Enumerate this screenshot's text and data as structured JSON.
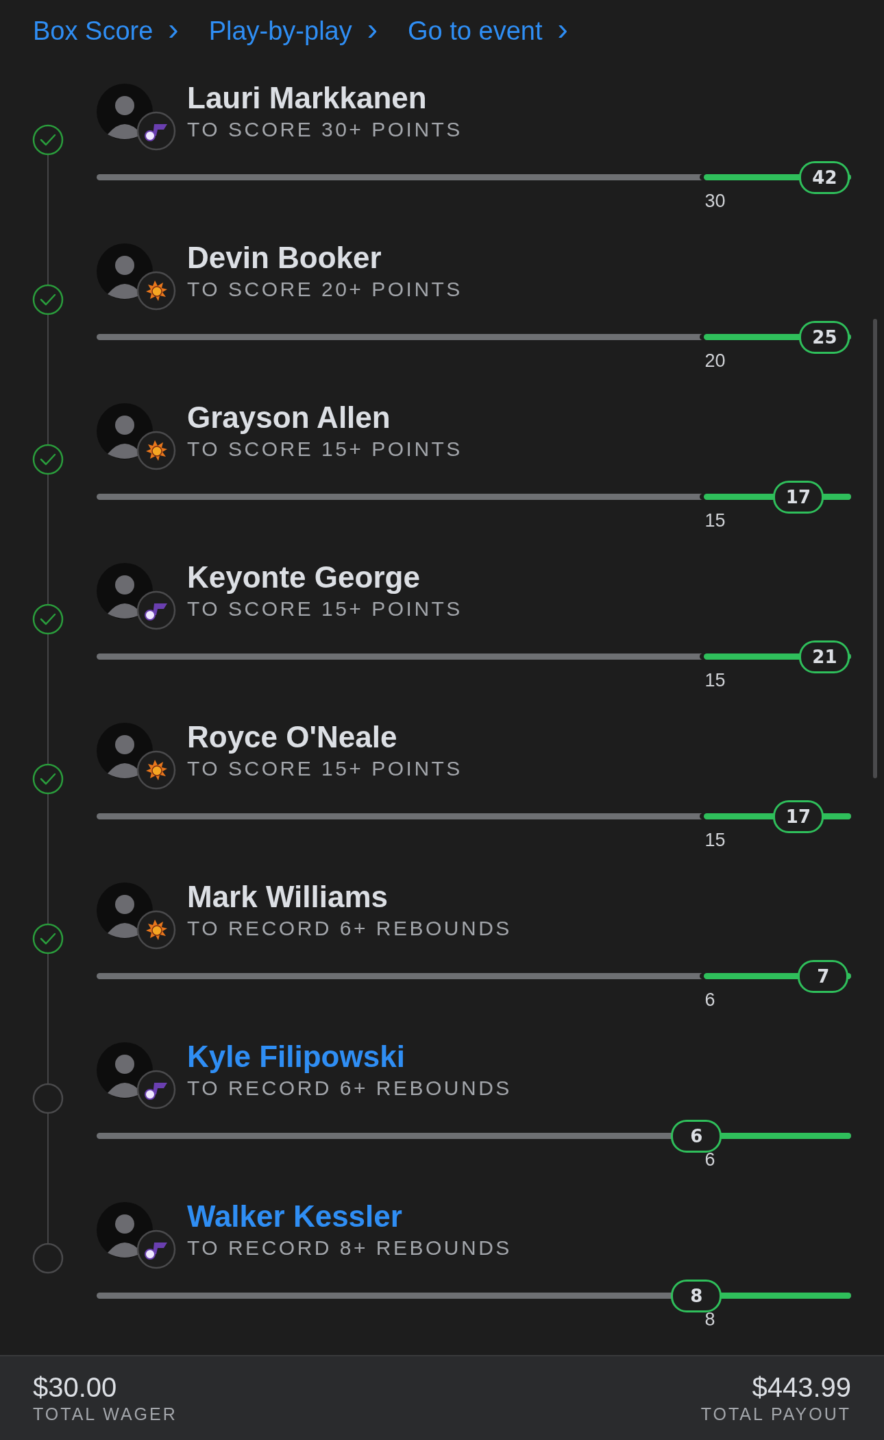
{
  "links": [
    {
      "label": "Box Score",
      "chevron": "›"
    },
    {
      "label": "Play-by-play",
      "chevron": "›"
    },
    {
      "label": "Go to event",
      "chevron": "›"
    }
  ],
  "legs": [
    {
      "name": "Lauri Markkanen",
      "prop": "TO SCORE 30+ POINTS",
      "hit": true,
      "kind": "note",
      "threshold": "30",
      "current": "42",
      "level": 0.965
    },
    {
      "name": "Devin Booker",
      "prop": "TO SCORE 20+ POINTS",
      "hit": true,
      "kind": "sun",
      "threshold": "20",
      "current": "25",
      "level": 0.965
    },
    {
      "name": "Grayson Allen",
      "prop": "TO SCORE 15+ POINTS",
      "hit": true,
      "kind": "sun",
      "threshold": "15",
      "current": "17",
      "level": 0.93
    },
    {
      "name": "Keyonte George",
      "prop": "TO SCORE 15+ POINTS",
      "hit": true,
      "kind": "note",
      "threshold": "15",
      "current": "21",
      "level": 0.965
    },
    {
      "name": "Royce O'Neale",
      "prop": "TO SCORE 15+ POINTS",
      "hit": true,
      "kind": "sun",
      "threshold": "15",
      "current": "17",
      "level": 0.93
    },
    {
      "name": "Mark Williams",
      "prop": "TO RECORD 6+ REBOUNDS",
      "hit": true,
      "kind": "sun",
      "threshold": "6",
      "current": "7",
      "level": 0.963
    },
    {
      "name": "Kyle Filipowski",
      "prop": "TO RECORD 6+ REBOUNDS",
      "hit": false,
      "kind": "note",
      "threshold": "6",
      "current": "6",
      "level": 0.795
    },
    {
      "name": "Walker Kessler",
      "prop": "TO RECORD 8+ REBOUNDS",
      "hit": false,
      "kind": "note",
      "threshold": "8",
      "current": "8",
      "level": 0.795
    }
  ],
  "footer": {
    "wager": "$30.00",
    "wager_label": "TOTAL WAGER",
    "payout": "$443.99",
    "payout_label": "TOTAL PAYOUT"
  }
}
